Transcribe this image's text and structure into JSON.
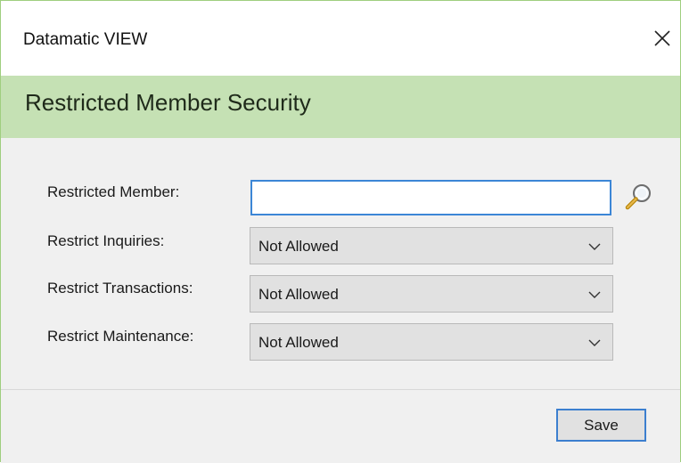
{
  "window": {
    "title": "Datamatic VIEW"
  },
  "header": {
    "heading": "Restricted Member Security"
  },
  "form": {
    "restricted_member": {
      "label": "Restricted Member:",
      "value": ""
    },
    "restrict_inquiries": {
      "label": "Restrict Inquiries:",
      "selected": "Not Allowed"
    },
    "restrict_transactions": {
      "label": "Restrict Transactions:",
      "selected": "Not Allowed"
    },
    "restrict_maintenance": {
      "label": "Restrict Maintenance:",
      "selected": "Not Allowed"
    }
  },
  "footer": {
    "save_label": "Save"
  },
  "icons": {
    "close": "close-icon",
    "search": "magnifier-icon",
    "dropdown": "chevron-down-icon"
  },
  "colors": {
    "header_band": "#c5e1b4",
    "window_border": "#9fce7f",
    "focus_border": "#3c86d6",
    "button_face": "#e1e1e1"
  }
}
